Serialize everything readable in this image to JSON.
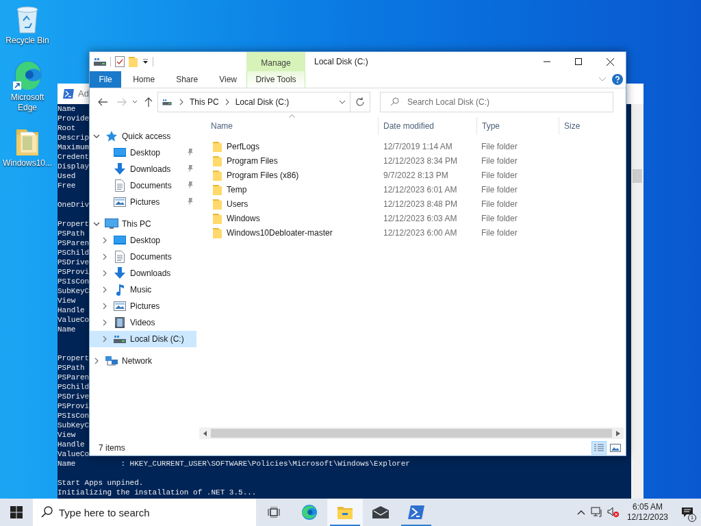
{
  "desktop_icons": [
    {
      "label": "Recycle Bin",
      "kind": "recycle"
    },
    {
      "label": "Microsoft Edge",
      "kind": "edge"
    },
    {
      "label": "Windows10...",
      "kind": "folder"
    }
  ],
  "powershell": {
    "title": "Ad",
    "sections": [
      {
        "blocks": [
          {
            "lines": [
              "Name",
              "Provide",
              "Root",
              "Descrip",
              "Maximum",
              "Credent",
              "Display",
              "Used",
              "Free"
            ]
          },
          {
            "lines": [
              "OneDriv"
            ]
          },
          {
            "lines": [
              "Propert",
              "PSPath",
              "PSParen",
              "PSChild",
              "PSDrive",
              "PSProvi",
              "PSIsCon",
              "SubKeyC",
              "View",
              "Handle",
              "ValueCo",
              "Name"
            ]
          }
        ]
      },
      {
        "blocks": [
          {
            "lines": [
              "Propert",
              "PSPath",
              "PSParen",
              "PSChild",
              "PSDrive",
              "PSProvi",
              "PSIsCon",
              "SubKeyC",
              "View",
              "Handle",
              "ValueCo",
              "Name          : HKEY_CURRENT_USER\\SOFTWARE\\Policies\\Microsoft\\Windows\\Explorer"
            ]
          },
          {
            "lines": [
              "Start Apps unpined.",
              "Initializing the installation of .NET 3.5..."
            ]
          }
        ]
      }
    ]
  },
  "explorer": {
    "title": "Local Disk (C:)",
    "context_group": "Manage",
    "ribbon_tabs": [
      {
        "label": "File",
        "kind": "file",
        "selected": false
      },
      {
        "label": "Home",
        "kind": "tab",
        "selected": false
      },
      {
        "label": "Share",
        "kind": "tab",
        "selected": false
      },
      {
        "label": "View",
        "kind": "tab",
        "selected": false
      },
      {
        "label": "Drive Tools",
        "kind": "context",
        "selected": false
      }
    ],
    "address": [
      "This PC",
      "Local Disk (C:)"
    ],
    "search": {
      "placeholder": "Search Local Disk (C:)"
    },
    "navigation": [
      {
        "label": "Quick access",
        "kind": "star",
        "expanded": true,
        "selected": false,
        "children": [
          {
            "label": "Desktop",
            "kind": "desktop",
            "pinned": true,
            "selected": false
          },
          {
            "label": "Downloads",
            "kind": "downloads",
            "pinned": true,
            "selected": false
          },
          {
            "label": "Documents",
            "kind": "documents",
            "pinned": true,
            "selected": false
          },
          {
            "label": "Pictures",
            "kind": "pictures",
            "pinned": true,
            "selected": false
          }
        ]
      },
      {
        "label": "This PC",
        "kind": "pc",
        "expanded": true,
        "selected": false,
        "children": [
          {
            "label": "Desktop",
            "kind": "desktop",
            "expanded": false,
            "selected": false
          },
          {
            "label": "Documents",
            "kind": "documents",
            "expanded": false,
            "selected": false
          },
          {
            "label": "Downloads",
            "kind": "downloads",
            "expanded": false,
            "selected": false
          },
          {
            "label": "Music",
            "kind": "music",
            "expanded": false,
            "selected": false
          },
          {
            "label": "Pictures",
            "kind": "pictures",
            "expanded": false,
            "selected": false
          },
          {
            "label": "Videos",
            "kind": "videos",
            "expanded": false,
            "selected": false
          },
          {
            "label": "Local Disk (C:)",
            "kind": "drive",
            "expanded": false,
            "selected": true
          }
        ]
      },
      {
        "label": "Network",
        "kind": "network",
        "expanded": false,
        "selected": false
      }
    ],
    "columns": [
      {
        "label": "Name",
        "sorted": true
      },
      {
        "label": "Date modified"
      },
      {
        "label": "Type"
      },
      {
        "label": "Size"
      }
    ],
    "files": [
      {
        "name": "PerfLogs",
        "date": "12/7/2019 1:14 AM",
        "type": "File folder"
      },
      {
        "name": "Program Files",
        "date": "12/12/2023 8:34 PM",
        "type": "File folder"
      },
      {
        "name": "Program Files (x86)",
        "date": "9/7/2022 8:13 PM",
        "type": "File folder"
      },
      {
        "name": "Temp",
        "date": "12/12/2023 6:01 AM",
        "type": "File folder"
      },
      {
        "name": "Users",
        "date": "12/12/2023 8:48 PM",
        "type": "File folder"
      },
      {
        "name": "Windows",
        "date": "12/12/2023 6:03 AM",
        "type": "File folder"
      },
      {
        "name": "Windows10Debloater-master",
        "date": "12/12/2023 6:00 AM",
        "type": "File folder"
      }
    ],
    "status": "7 items",
    "views": [
      {
        "kind": "details",
        "selected": true
      },
      {
        "kind": "large_icons",
        "selected": false
      }
    ]
  },
  "taskbar": {
    "search_placeholder": "Type here to search",
    "apps": [
      {
        "kind": "task_view",
        "running": false,
        "selected": false
      },
      {
        "kind": "edge",
        "running": false,
        "selected": false
      },
      {
        "kind": "explorer",
        "running": true,
        "selected": true
      },
      {
        "kind": "mail",
        "running": false,
        "selected": false
      },
      {
        "kind": "powershell",
        "running": true,
        "selected": false
      }
    ],
    "time": "6:05 AM",
    "date": "12/12/2023",
    "notifications": "1"
  }
}
